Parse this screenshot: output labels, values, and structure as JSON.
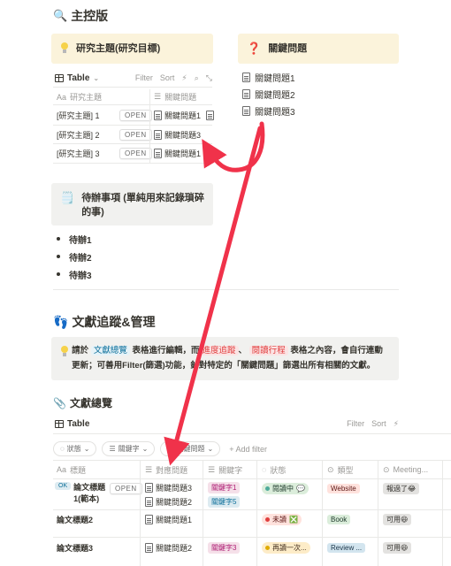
{
  "page": {
    "title": "主控版",
    "title_icon": "magnifier-icon"
  },
  "research_callout": {
    "text": "研究主題(研究目標)",
    "icon": "lightbulb-icon"
  },
  "question_callout": {
    "text": "關鍵問題",
    "icon": "question-mark-icon"
  },
  "question_links": [
    "關鍵問題1",
    "關鍵問題2",
    "關鍵問題3"
  ],
  "research_table": {
    "view_label": "Table",
    "tools": {
      "filter": "Filter",
      "sort": "Sort"
    },
    "col_title": "研究主題",
    "col_title_prefix": "Aa",
    "col_rel": "關鍵問題",
    "open_label": "OPEN",
    "rows": [
      {
        "title": "[研究主題] 1",
        "rel": "關鍵問題1"
      },
      {
        "title": "[研究主題] 2",
        "rel": "關鍵問題3"
      },
      {
        "title": "[研究主題] 3",
        "rel": "關鍵問題1"
      }
    ]
  },
  "todo_callout": {
    "text": "待辦事項 (單純用來記錄瑣碎的事)",
    "icon": "notepad-icon"
  },
  "todos": [
    "待辦1",
    "待辦2",
    "待辦3"
  ],
  "lit_section": {
    "title": "文獻追蹤&管理",
    "icon": "footprints-icon"
  },
  "info_callout": {
    "p1": "請於",
    "code1": "文獻總覽",
    "p2": "表格進行編輯，而",
    "code2": "進度追蹤",
    "p3": "、",
    "code3": "閱讀行程",
    "p4": "表格之內容，會自行連動更新；可善用Filter(篩選)功能，針對特定的「關鍵問題」篩選出所有相關的文獻。"
  },
  "lit_overview": {
    "title": "文獻總覽",
    "icon": "paperclip-icon"
  },
  "lit_table": {
    "view_label": "Table",
    "tools": {
      "filter": "Filter",
      "sort": "Sort"
    },
    "chips": [
      "狀態",
      "關鍵字",
      "關鍵問題"
    ],
    "add_filter": "+ Add filter",
    "headers": {
      "title": "標題",
      "title_prefix": "Aa",
      "rel": "對應問題",
      "keyword": "關鍵字",
      "status": "狀態",
      "type": "類型",
      "meeting": "Meeting..."
    },
    "open_label": "OPEN",
    "rows": [
      {
        "title_line1": "論文標題",
        "title_line2": "1(範本)",
        "badge": "OK",
        "rel": [
          "關鍵問題3",
          "關鍵問題2"
        ],
        "keywords": [
          "關鍵字1",
          "關鍵字5"
        ],
        "status": "閱讀中",
        "status_emoji": "💬",
        "type": "Website",
        "meeting": "報過了",
        "meeting_emoji": "😂"
      },
      {
        "title_line1": "論文標題2",
        "rel": [
          "關鍵問題1"
        ],
        "keywords": [],
        "status": "未讀",
        "status_emoji": "❎",
        "type": "Book",
        "meeting": "可用",
        "meeting_emoji": "😆"
      },
      {
        "title_line1": "論文標題3",
        "rel": [
          "關鍵問題2"
        ],
        "keywords": [
          "關鍵字3"
        ],
        "status": "再讀一次...",
        "status_emoji": "",
        "type": "Review ...",
        "meeting": "可用",
        "meeting_emoji": "😆"
      }
    ]
  },
  "colors": {
    "arrow": "#f0324a",
    "callout_yellow": "#fbf3db",
    "callout_gray": "#f1f1ef"
  }
}
